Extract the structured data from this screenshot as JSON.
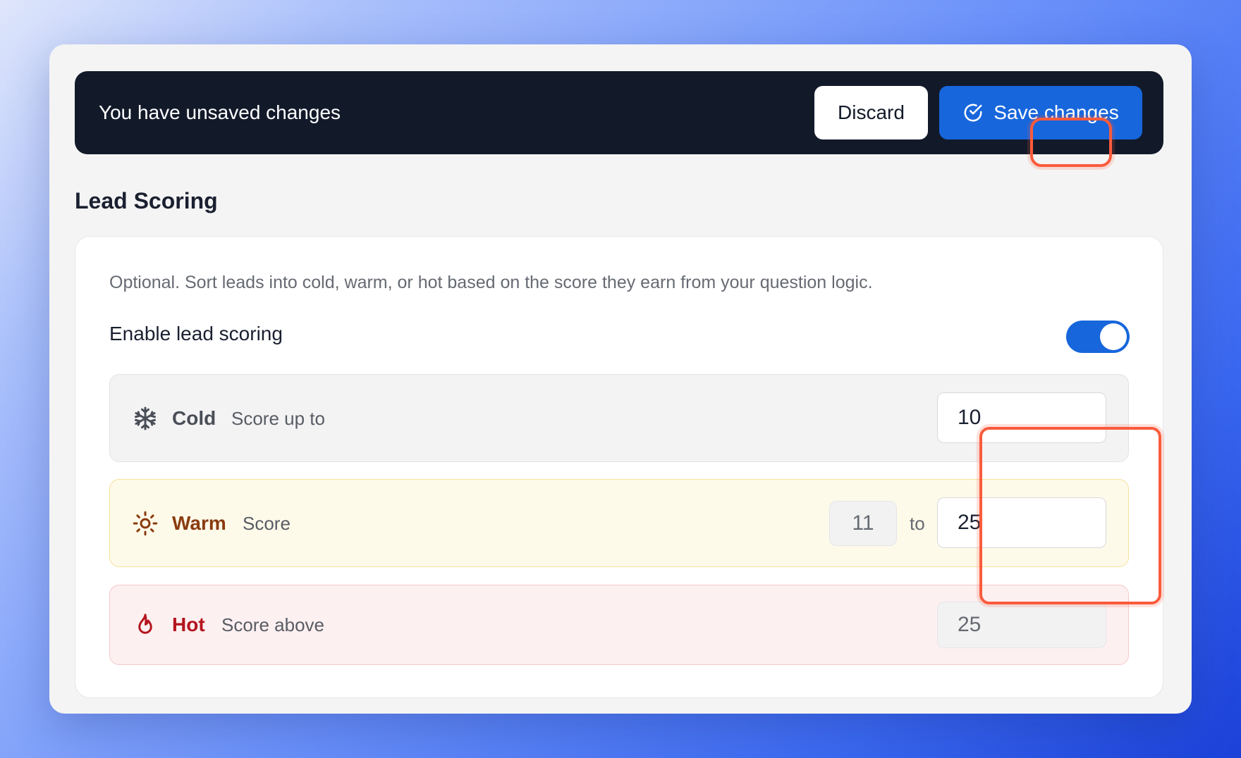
{
  "banner": {
    "message": "You have unsaved changes",
    "discard_label": "Discard",
    "save_label": "Save changes"
  },
  "section": {
    "title": "Lead Scoring",
    "description": "Optional. Sort leads into cold, warm, or hot based on the score they earn from your question logic.",
    "enable_label": "Enable lead scoring",
    "enabled": true
  },
  "tiers": {
    "cold": {
      "name": "Cold",
      "label": "Score up to",
      "max": "10",
      "icon": "snowflake-icon"
    },
    "warm": {
      "name": "Warm",
      "label": "Score",
      "min": "11",
      "separator": "to",
      "max": "25",
      "icon": "sun-icon"
    },
    "hot": {
      "name": "Hot",
      "label": "Score above",
      "min": "25",
      "icon": "flame-icon"
    }
  },
  "colors": {
    "banner_bg": "#121a2a",
    "accent": "#1766dc",
    "highlight": "#fa5b3c",
    "warm_text": "#8a3c10",
    "hot_text": "#b4141e"
  }
}
